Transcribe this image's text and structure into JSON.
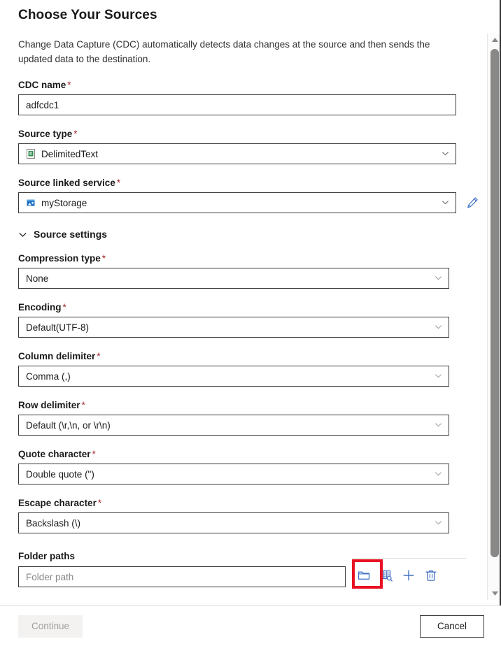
{
  "header": {
    "title": "Choose Your Sources",
    "description": "Change Data Capture (CDC) automatically detects data changes at the source and then sends the updated data to the destination."
  },
  "form": {
    "cdc_name": {
      "label": "CDC name",
      "required": "*",
      "value": "adfcdc1"
    },
    "source_type": {
      "label": "Source type",
      "required": "*",
      "value": "DelimitedText",
      "icon": "delimited-text-icon"
    },
    "source_linked_service": {
      "label": "Source linked service",
      "required": "*",
      "value": "myStorage",
      "icon": "azure-storage-icon",
      "edit_icon": "pencil-icon"
    },
    "source_settings": {
      "label": "Source settings",
      "chevron": "chevron-down-icon",
      "expanded": true
    },
    "compression_type": {
      "label": "Compression type",
      "required": "*",
      "value": "None"
    },
    "encoding": {
      "label": "Encoding",
      "required": "*",
      "value": "Default(UTF-8)"
    },
    "column_delimiter": {
      "label": "Column delimiter",
      "required": "*",
      "value": "Comma (,)"
    },
    "row_delimiter": {
      "label": "Row delimiter",
      "required": "*",
      "value": "Default (\\r,\\n, or \\r\\n)"
    },
    "quote_character": {
      "label": "Quote character",
      "required": "*",
      "value": "Double quote (\")"
    },
    "escape_character": {
      "label": "Escape character",
      "required": "*",
      "value": "Backslash (\\)"
    },
    "folder_paths": {
      "label": "Folder paths",
      "placeholder": "Folder path",
      "value": "",
      "actions": [
        {
          "name": "browse-folder-button",
          "icon": "folder-icon",
          "highlighted": true
        },
        {
          "name": "preview-data-button",
          "icon": "table-preview-icon",
          "highlighted": false
        },
        {
          "name": "add-folder-path-button",
          "icon": "plus-icon",
          "highlighted": false
        },
        {
          "name": "delete-folder-path-button",
          "icon": "trash-icon",
          "highlighted": false
        }
      ]
    }
  },
  "footer": {
    "continue_label": "Continue",
    "continue_disabled": true,
    "cancel_label": "Cancel"
  },
  "scrollbar": {
    "up_arrow_icon": "triangle-up-icon",
    "down_arrow_icon": "triangle-down-icon"
  },
  "colors": {
    "highlight": "#e81123",
    "required_asterisk": "#a4262c",
    "icon_blue": "#4271c6",
    "text": "#1b1a19",
    "placeholder": "#87868a"
  }
}
